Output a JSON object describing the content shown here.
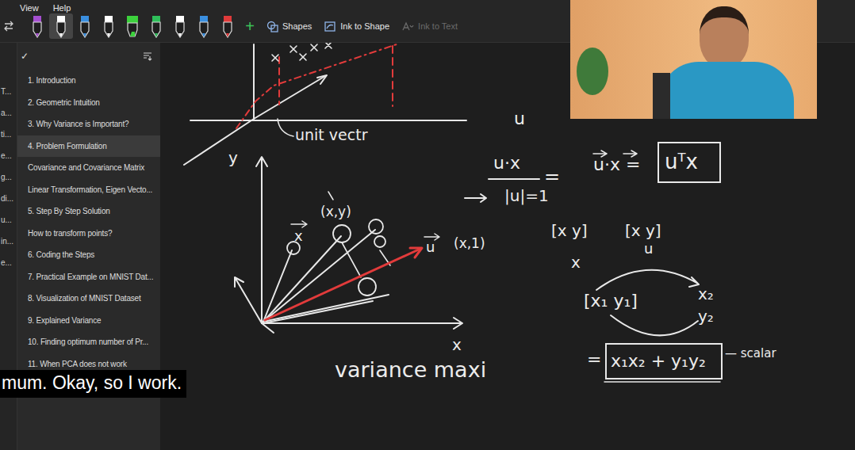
{
  "menu": [
    "View",
    "Help"
  ],
  "pens": [
    {
      "color": "#a64fd0",
      "kind": "pen",
      "selected": false
    },
    {
      "color": "#ffffff",
      "kind": "pen",
      "selected": true
    },
    {
      "color": "#3a8fe0",
      "kind": "pen",
      "selected": false
    },
    {
      "color": "#ffffff",
      "kind": "pen",
      "selected": false
    },
    {
      "color": "#3cd13c",
      "kind": "highlighter",
      "selected": false
    },
    {
      "color": "#2fbf5a",
      "kind": "pen",
      "selected": false
    },
    {
      "color": "#ffffff",
      "kind": "pen",
      "selected": false
    },
    {
      "color": "#3a8fe0",
      "kind": "pen",
      "selected": false
    },
    {
      "color": "#e03a3a",
      "kind": "pen",
      "selected": false
    }
  ],
  "add_pen": "+",
  "tools": [
    {
      "label": "Shapes",
      "disabled": false
    },
    {
      "label": "Ink to Shape",
      "disabled": false
    },
    {
      "label": "Ink to Text",
      "disabled": true
    }
  ],
  "left_strip": [
    "T...",
    "a...",
    "ti...",
    "e...",
    "g...",
    "di...",
    "u...",
    "in...",
    "e..."
  ],
  "sidebar": {
    "toggle": "✓",
    "items": [
      {
        "label": "1. Introduction",
        "selected": false
      },
      {
        "label": "2. Geometric Intuition",
        "selected": false
      },
      {
        "label": "3. Why Variance is Important?",
        "selected": false
      },
      {
        "label": "4. Problem Formulation",
        "selected": true
      },
      {
        "label": "Covariance and Covariance Matrix",
        "selected": false
      },
      {
        "label": "Linear Transformation, Eigen Vecto...",
        "selected": false
      },
      {
        "label": "5. Step By Step Solution",
        "selected": false
      },
      {
        "label": "How to transform points?",
        "selected": false
      },
      {
        "label": "6. Coding the Steps",
        "selected": false
      },
      {
        "label": "7. Practical Example on MNIST Dat...",
        "selected": false
      },
      {
        "label": "8. Visualization of MNIST Dataset",
        "selected": false
      },
      {
        "label": "9. Explained Variance",
        "selected": false
      },
      {
        "label": "10. Finding optimum number of Pr...",
        "selected": false
      },
      {
        "label": "11. When PCA does not work",
        "selected": false
      }
    ]
  },
  "canvas": {
    "ink_labels": [
      "unit vectr",
      "y",
      "x",
      "(x,y)",
      "x",
      "u",
      "(x,1)",
      "variance maxi",
      "u",
      "u·x",
      "|u|=1",
      "=",
      "u·x =",
      "uᵀx",
      "[x y]",
      "[x y]",
      "x",
      "u",
      "[x₁ y₁]",
      "x₂",
      "y₂",
      "=",
      "x₁x₂ + y₁y₂",
      "— scalar"
    ]
  },
  "caption": "mum. Okay, so I work."
}
